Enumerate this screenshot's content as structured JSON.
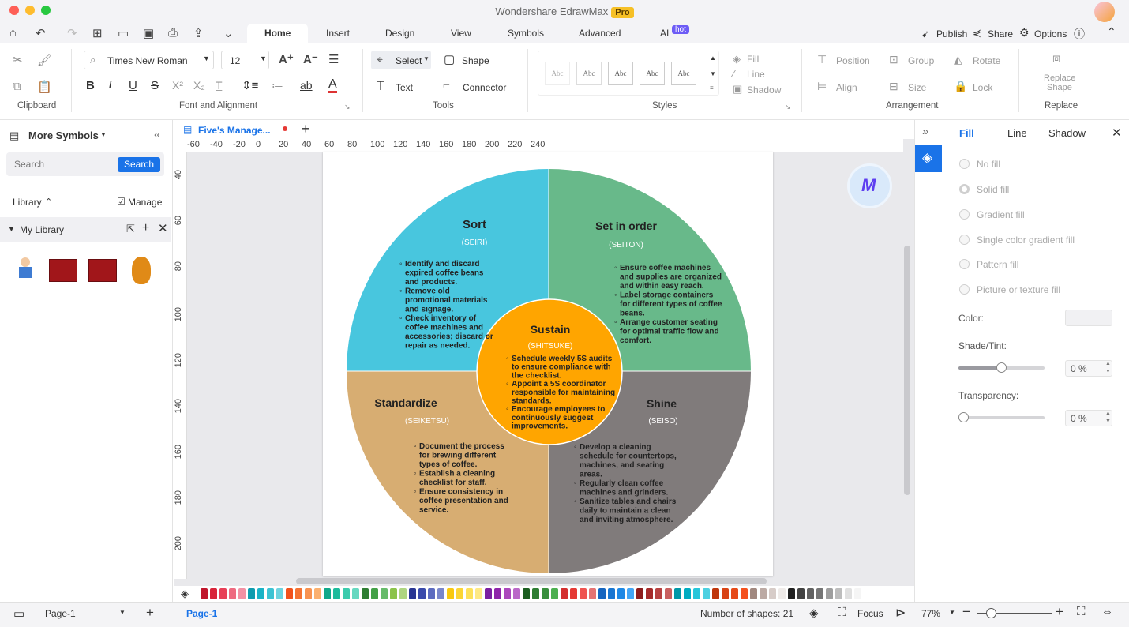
{
  "window": {
    "title": "Wondershare EdrawMax",
    "badge": "Pro"
  },
  "tabs": [
    {
      "label": "Home"
    },
    {
      "label": "Insert"
    },
    {
      "label": "Design"
    },
    {
      "label": "View"
    },
    {
      "label": "Symbols"
    },
    {
      "label": "Advanced"
    },
    {
      "label": "AI"
    }
  ],
  "ai_badge": "hot",
  "topright": {
    "publish": "Publish",
    "share": "Share",
    "options": "Options"
  },
  "ribbon": {
    "clipboard_label": "Clipboard",
    "font_name": "Times New Roman",
    "font_size": "12",
    "font_group_label": "Font and Alignment",
    "select": "Select",
    "shape": "Shape",
    "text": "Text",
    "connector": "Connector",
    "tools_label": "Tools",
    "style_sample": "Abc",
    "fill": "Fill",
    "line": "Line",
    "shadow": "Shadow",
    "styles_label": "Styles",
    "position": "Position",
    "group": "Group",
    "rotate": "Rotate",
    "align": "Align",
    "size": "Size",
    "lock": "Lock",
    "arrangement_label": "Arrangement",
    "replace_shape_1": "Replace",
    "replace_shape_2": "Shape",
    "replace_label": "Replace"
  },
  "left": {
    "title": "More Symbols",
    "search_placeholder": "Search",
    "search_button": "Search",
    "library": "Library",
    "manage": "Manage",
    "my_library": "My Library"
  },
  "doc": {
    "tab_name": "Five's Manage..."
  },
  "hruler": [
    "-60",
    "-40",
    "-20",
    "0",
    "20",
    "40",
    "60",
    "80",
    "100",
    "120",
    "140",
    "160",
    "180",
    "200",
    "220",
    "240"
  ],
  "vruler": [
    "40",
    "60",
    "80",
    "100",
    "120",
    "140",
    "160",
    "180",
    "200"
  ],
  "diagram": {
    "sort": {
      "title": "Sort",
      "sub": "(SEIRI)",
      "bullets": [
        "Identify and discard",
        "expired coffee beans",
        "and products.",
        "Remove old",
        "promotional materials",
        "and signage.",
        "Check inventory of",
        "coffee machines and",
        "accessories; discard or",
        "repair as needed."
      ]
    },
    "setinorder": {
      "title": "Set in order",
      "sub": "(SEITON)",
      "bullets": [
        "Ensure coffee machines",
        "and supplies are organized",
        "and within easy reach.",
        "Label storage containers",
        "for different types of coffee",
        "beans.",
        "Arrange customer seating",
        "for optimal traffic flow and",
        "comfort."
      ]
    },
    "standardize": {
      "title": "Standardize",
      "sub": "(SEIKETSU)",
      "bullets": [
        "Document the process",
        "for brewing different",
        "types of coffee.",
        "Establish a cleaning",
        "checklist for staff.",
        "Ensure consistency in",
        "coffee presentation and",
        "service."
      ]
    },
    "shine": {
      "title": "Shine",
      "sub": "(SEISO)",
      "bullets": [
        "Develop a cleaning",
        "schedule for countertops,",
        "machines, and seating",
        "areas.",
        "Regularly clean coffee",
        "machines and grinders.",
        "Sanitize tables and chairs",
        "daily to maintain a clean",
        "and inviting atmosphere."
      ]
    },
    "sustain": {
      "title": "Sustain",
      "sub": "(SHITSUKE)",
      "bullets": [
        "Schedule weekly 5S audits",
        "to ensure compliance with",
        "the checklist.",
        "Appoint a 5S coordinator",
        "responsible for maintaining",
        "standards.",
        "Encourage employees to",
        "continuously suggest",
        "improvements."
      ]
    },
    "colors": {
      "sort": "#48c6de",
      "setinorder": "#68b98a",
      "standardize": "#d7ad72",
      "shine": "#807b7b",
      "sustain": "#ffa500"
    }
  },
  "right": {
    "tab_fill": "Fill",
    "tab_line": "Line",
    "tab_shadow": "Shadow",
    "options": [
      "No fill",
      "Solid fill",
      "Gradient fill",
      "Single color gradient fill",
      "Pattern fill",
      "Picture or texture fill"
    ],
    "color_label": "Color:",
    "shade_label": "Shade/Tint:",
    "shade_value": "0 %",
    "transparency_label": "Transparency:",
    "transparency_value": "0 %"
  },
  "status": {
    "page_select": "Page-1",
    "page_tab": "Page-1",
    "shapes": "Number of shapes: 21",
    "focus": "Focus",
    "zoom": "77%"
  }
}
